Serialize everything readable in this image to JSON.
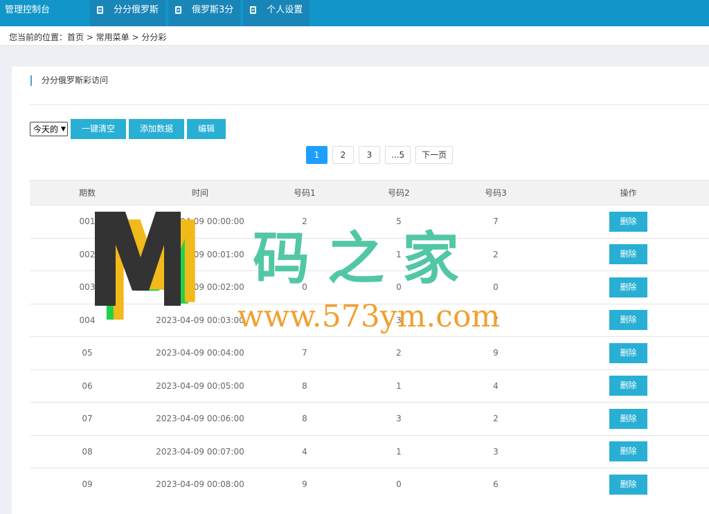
{
  "topbar": {
    "brand": "管理控制台",
    "nav": [
      {
        "label": "分分俄罗斯"
      },
      {
        "label": "俄罗斯3分"
      },
      {
        "label": "个人设置"
      }
    ]
  },
  "breadcrumb": "您当前的位置：首页 > 常用菜单 > 分分彩",
  "panel": {
    "title": "分分俄罗斯彩访问",
    "filter_value": "今天的",
    "buttons": [
      "一键清空",
      "添加数据",
      "编辑"
    ]
  },
  "pagination": [
    "1",
    "2",
    "3",
    "...5",
    "下一页"
  ],
  "table": {
    "headers": [
      "期数",
      "时间",
      "号码1",
      "号码2",
      "号码3",
      "操作"
    ],
    "delete_label": "删除",
    "rows": [
      {
        "issue": "001",
        "time": "2023-04-09 00:00:00",
        "n1": "2",
        "n2": "5",
        "n3": "7"
      },
      {
        "issue": "002",
        "time": "2023-04-09 00:01:00",
        "n1": "",
        "n2": "1",
        "n3": "2"
      },
      {
        "issue": "003",
        "time": "2023-04-09 00:02:00",
        "n1": "0",
        "n2": "0",
        "n3": "0"
      },
      {
        "issue": "004",
        "time": "2023-04-09 00:03:00",
        "n1": "",
        "n2": "3",
        "n3": "7"
      },
      {
        "issue": "05",
        "time": "2023-04-09 00:04:00",
        "n1": "7",
        "n2": "2",
        "n3": "9"
      },
      {
        "issue": "06",
        "time": "2023-04-09 00:05:00",
        "n1": "8",
        "n2": "1",
        "n3": "4"
      },
      {
        "issue": "07",
        "time": "2023-04-09 00:06:00",
        "n1": "8",
        "n2": "3",
        "n3": "2"
      },
      {
        "issue": "08",
        "time": "2023-04-09 00:07:00",
        "n1": "4",
        "n2": "1",
        "n3": "3"
      },
      {
        "issue": "09",
        "time": "2023-04-09 00:08:00",
        "n1": "9",
        "n2": "0",
        "n3": "6"
      }
    ]
  },
  "watermark": {
    "text": "码之家",
    "url": "www.573ym.com"
  },
  "colors": {
    "topbar": "#1296c9",
    "button": "#29afd4",
    "active_page": "#1e9fff"
  }
}
